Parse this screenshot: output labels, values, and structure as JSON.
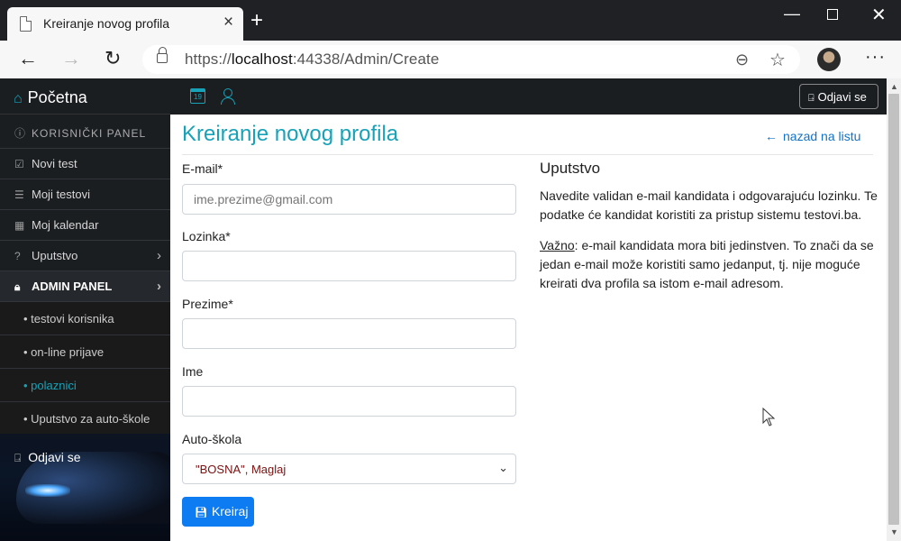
{
  "browser": {
    "tab_title": "Kreiranje novog profila",
    "url_scheme": "https://",
    "url_host": "localhost",
    "url_rest": ":44338/Admin/Create"
  },
  "sidebar": {
    "brand": "Početna",
    "user_panel": "KORISNIČKI PANEL",
    "items": [
      {
        "label": "Novi test",
        "icon": "checkbox-icon"
      },
      {
        "label": "Moji testovi",
        "icon": "list-icon"
      },
      {
        "label": "Moj kalendar",
        "icon": "grid-icon"
      },
      {
        "label": "Uputstvo",
        "icon": "question-icon"
      }
    ],
    "admin_panel": "ADMIN PANEL",
    "sub_items": [
      {
        "label": "• testovi korisnika"
      },
      {
        "label": "• on-line prijave"
      },
      {
        "label": "• polaznici"
      },
      {
        "label": "• Uputstvo za auto-škole"
      }
    ],
    "logout": "Odjavi se"
  },
  "topbar": {
    "calendar_day": "19",
    "logout": "Odjavi se"
  },
  "main": {
    "title": "Kreiranje novog profila",
    "back_link": "nazad na listu",
    "email_label": "E-mail*",
    "email_placeholder": "ime.prezime@gmail.com",
    "password_label": "Lozinka*",
    "surname_label": "Prezime*",
    "name_label": "Ime",
    "school_label": "Auto-škola",
    "school_value": "\"BOSNA\", Maglaj",
    "submit": "Kreiraj"
  },
  "help": {
    "title": "Uputstvo",
    "para1": "Navedite validan e-mail kandidata i odgovarajuću lozinku. Te podatke će kandidat koristiti za pristup sistemu testovi.ba.",
    "para2_prefix": "Važno",
    "para2_rest": ": e-mail kandidata mora biti jedinstven. To znači da se jedan e-mail može koristiti samo jedanput, tj. nije moguće kreirati dva profila sa istom e-mail adresom."
  },
  "colors": {
    "accent": "#17a2b8",
    "primary_button": "#0d7bf2",
    "sidebar_bg": "#1b1e21"
  }
}
